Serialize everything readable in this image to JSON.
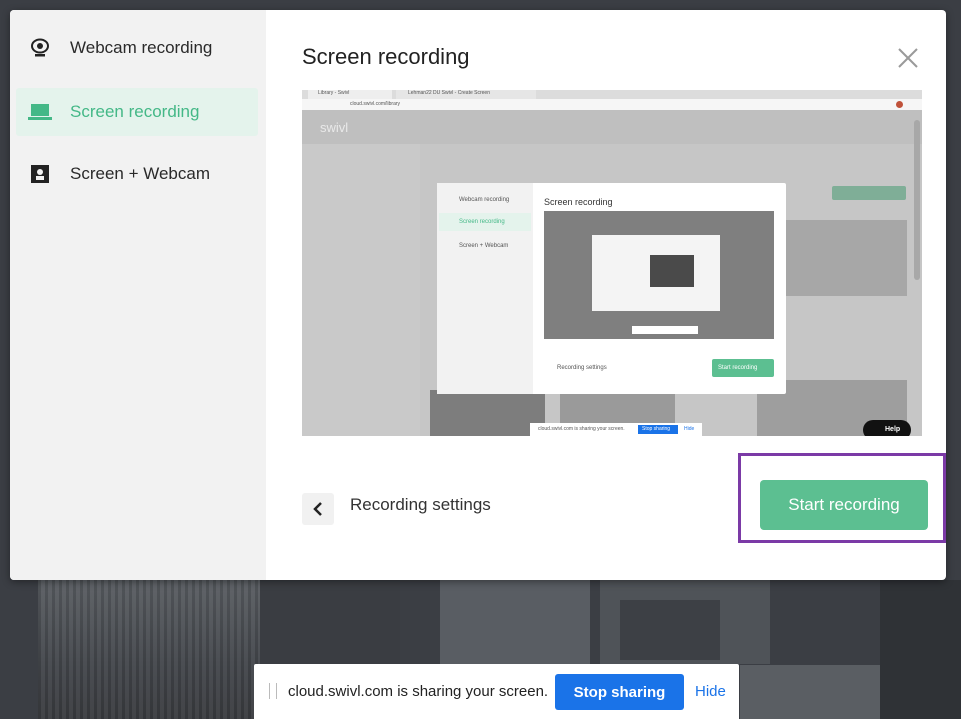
{
  "modal": {
    "title": "Screen recording",
    "sidebar": {
      "items": [
        {
          "label": "Webcam recording",
          "icon": "webcam-icon",
          "active": false
        },
        {
          "label": "Screen recording",
          "icon": "laptop-icon",
          "active": true
        },
        {
          "label": "Screen + Webcam",
          "icon": "screen-webcam-icon",
          "active": false
        }
      ]
    },
    "footer": {
      "settings_label": "Recording settings",
      "start_label": "Start recording"
    }
  },
  "preview": {
    "browser_tab_1": "Library - Swivl",
    "browser_tab_2": "Lehman22 DU Swivl - Create Screen",
    "address": "cloud.swivl.com/library",
    "logo": "swivl",
    "inner_title": "Screen recording",
    "inner_sidebar": [
      "Webcam recording",
      "Screen recording",
      "Screen + Webcam"
    ],
    "inner_settings": "Recording settings",
    "inner_start": "Start recording",
    "inner_share_text": "cloud.swivl.com is sharing your screen.",
    "inner_stop": "Stop sharing",
    "inner_hide": "Hide",
    "help": "Help"
  },
  "share_bar": {
    "text": "cloud.swivl.com is sharing your screen.",
    "stop_label": "Stop sharing",
    "hide_label": "Hide"
  },
  "colors": {
    "accent": "#5cbf91",
    "accent_text": "#44b887",
    "highlight_outline": "#7b3aa6",
    "chrome_blue": "#1a73e8"
  }
}
